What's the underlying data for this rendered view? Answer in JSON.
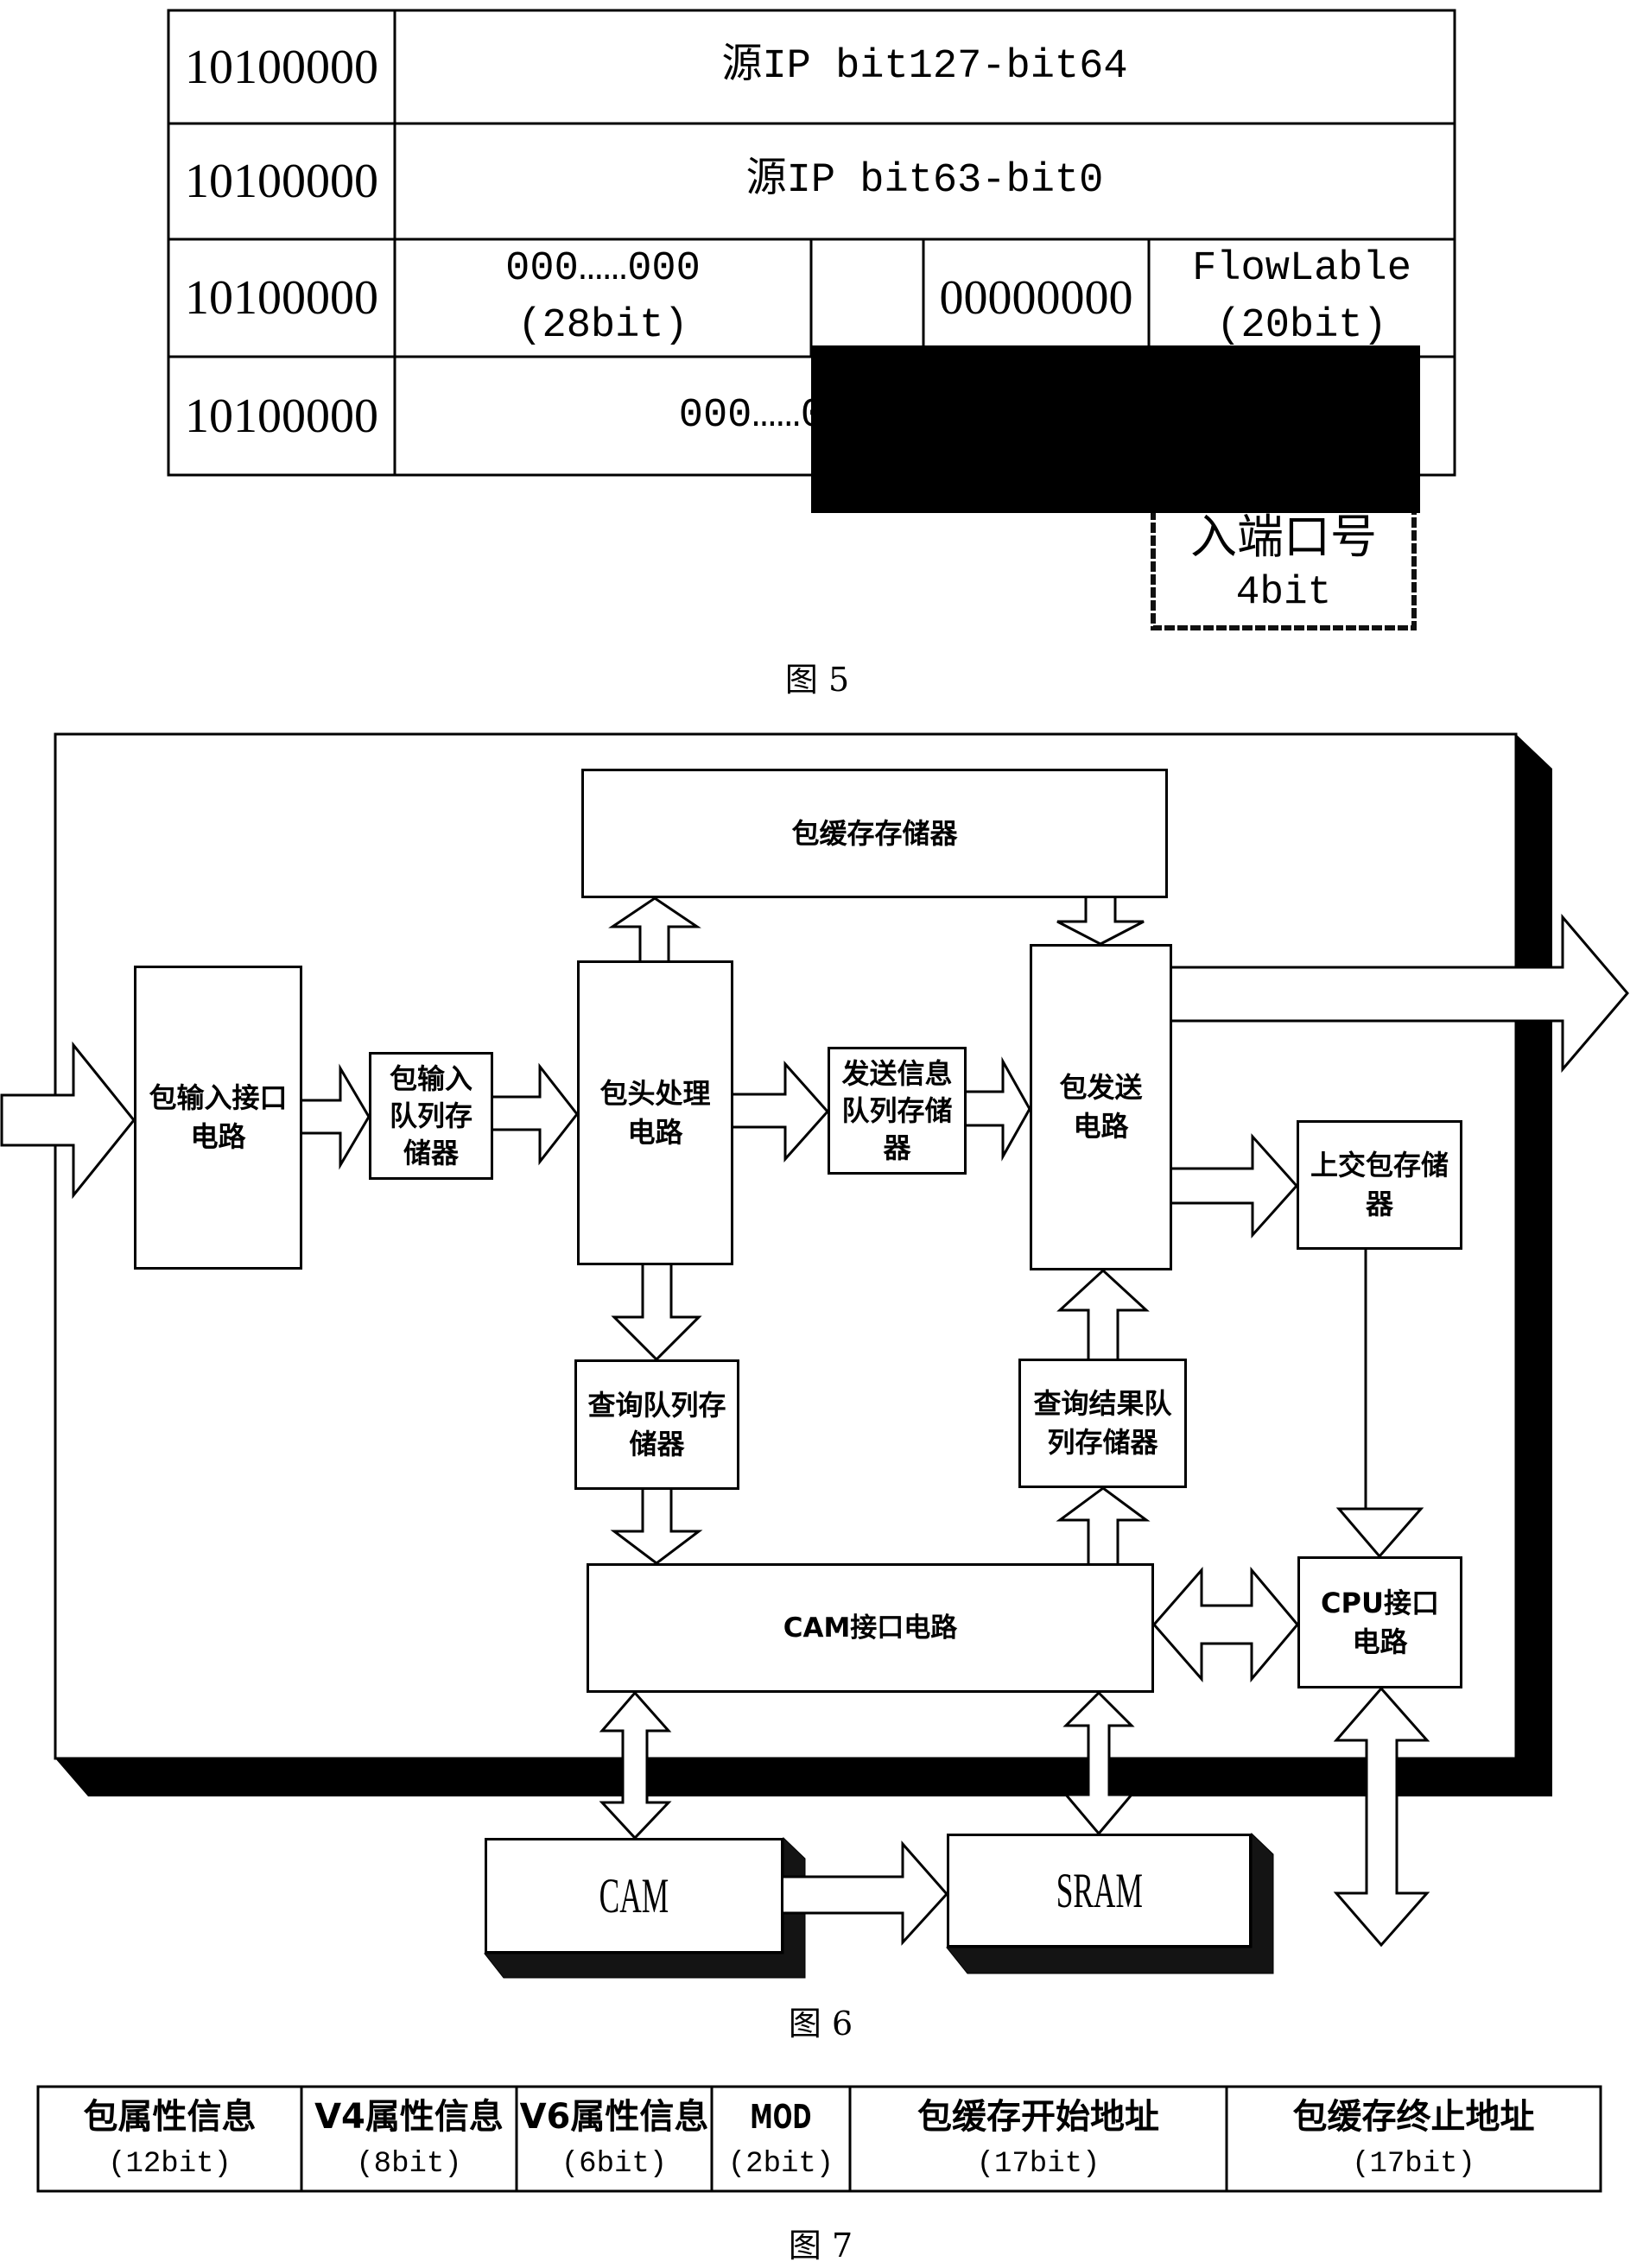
{
  "figure5": {
    "caption": "图 5",
    "rows": [
      {
        "prefix": "10100000",
        "field": "源IP bit127-bit64"
      },
      {
        "prefix": "10100000",
        "field": "源IP bit63-bit0"
      },
      {
        "prefix": "10100000",
        "cells": [
          {
            "value": "000……000",
            "bits": "(28bit)"
          },
          {
            "value": "00000000"
          },
          {
            "value": "FlowLable",
            "bits": "(20bit)"
          }
        ]
      },
      {
        "prefix": "10100000",
        "field_visible": "000……0"
      }
    ],
    "overflow_box": {
      "label": "入端口号",
      "bits": "4bit"
    }
  },
  "figure6": {
    "caption": "图 6",
    "blocks": {
      "packet_buffer_memory": [
        "包缓存存储器"
      ],
      "packet_input_interface": [
        "包输入接口",
        "电路"
      ],
      "packet_input_queue_memory": [
        "包输入",
        "队列存",
        "储器"
      ],
      "header_processing": [
        "包头处理",
        "电路"
      ],
      "send_info_queue_memory": [
        "发送信息",
        "队列存储",
        "器"
      ],
      "packet_send": [
        "包发送",
        "电路"
      ],
      "upload_packet_memory": [
        "上交包存储",
        "器"
      ],
      "lookup_queue_memory": [
        "查询队列存",
        "储器"
      ],
      "lookup_result_queue_memory": [
        "查询结果队",
        "列存储器"
      ],
      "cam_interface": [
        "CAM接口电路"
      ],
      "cpu_interface": [
        "CPU接口",
        "电路"
      ]
    },
    "chips": {
      "cam": "CAM",
      "sram": "SRAM"
    }
  },
  "figure7": {
    "caption": "图 7",
    "fields": [
      {
        "name": "包属性信息",
        "bits": "(12bit)"
      },
      {
        "name": "V4属性信息",
        "bits": "(8bit)"
      },
      {
        "name": "V6属性信息",
        "bits": "(6bit)"
      },
      {
        "name": "MOD",
        "bits": "(2bit)"
      },
      {
        "name": "包缓存开始地址",
        "bits": "(17bit)"
      },
      {
        "name": "包缓存终止地址",
        "bits": "(17bit)"
      }
    ]
  }
}
